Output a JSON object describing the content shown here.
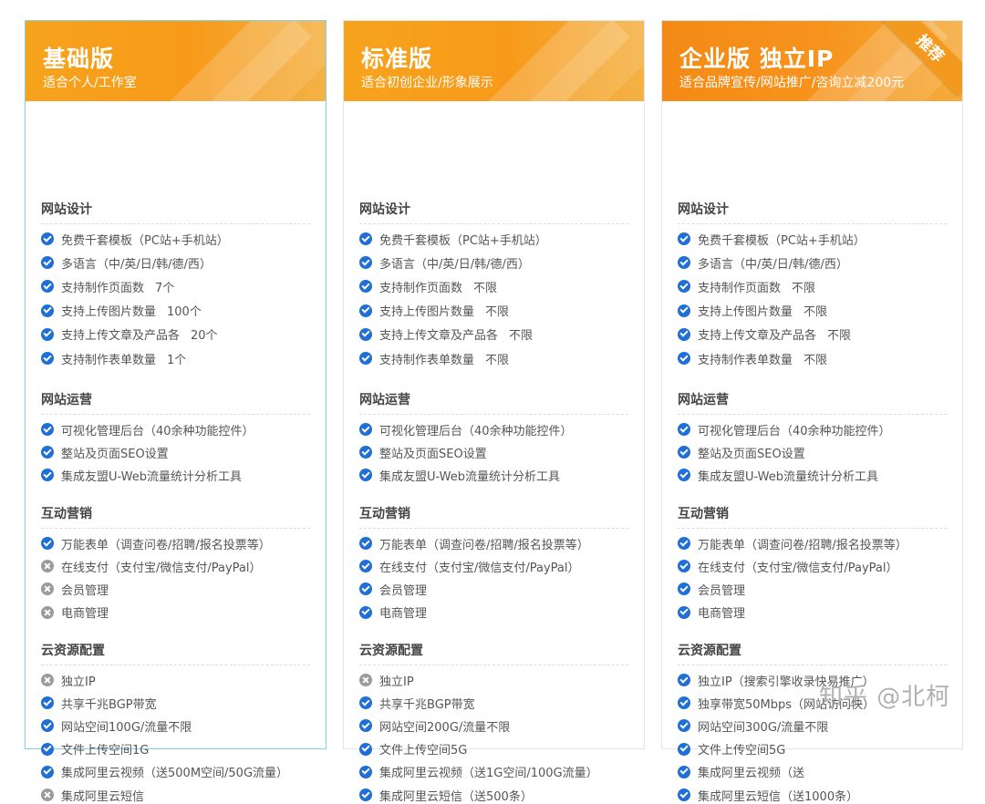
{
  "plans": [
    {
      "title": "基础版",
      "subtitle": "适合个人/工作室",
      "badge": "",
      "sections": [
        {
          "title": "网站设计",
          "items": [
            {
              "text": "免费千套模板（PC站+手机站）",
              "value": "",
              "status": "check"
            },
            {
              "text": "多语言（中/英/日/韩/德/西）",
              "value": "",
              "status": "check"
            },
            {
              "text": "支持制作页面数",
              "value": "7个",
              "status": "check"
            },
            {
              "text": "支持上传图片数量",
              "value": "100个",
              "status": "check"
            },
            {
              "text": "支持上传文章及产品各",
              "value": "20个",
              "status": "check"
            },
            {
              "text": "支持制作表单数量",
              "value": "1个",
              "status": "check"
            }
          ]
        },
        {
          "title": "网站运营",
          "items": [
            {
              "text": "可视化管理后台（40余种功能控件）",
              "value": "",
              "status": "check"
            },
            {
              "text": "整站及页面SEO设置",
              "value": "",
              "status": "check"
            },
            {
              "text": "集成友盟U-Web流量统计分析工具",
              "value": "",
              "status": "check"
            }
          ]
        },
        {
          "title": "互动营销",
          "items": [
            {
              "text": "万能表单（调查问卷/招聘/报名投票等）",
              "value": "",
              "status": "check"
            },
            {
              "text": "在线支付（支付宝/微信支付/PayPal）",
              "value": "",
              "status": "cross"
            },
            {
              "text": "会员管理",
              "value": "",
              "status": "cross"
            },
            {
              "text": "电商管理",
              "value": "",
              "status": "cross"
            }
          ]
        },
        {
          "title": "云资源配置",
          "items": [
            {
              "text": "独立IP",
              "value": "",
              "status": "cross"
            },
            {
              "text": "共享千兆BGP带宽",
              "value": "",
              "status": "check"
            },
            {
              "text": "网站空间100G/流量不限",
              "value": "",
              "status": "check"
            },
            {
              "text": "文件上传空间1G",
              "value": "",
              "status": "check"
            },
            {
              "text": "集成阿里云视频（送500M空间/50G流量）",
              "value": "",
              "status": "check"
            },
            {
              "text": "集成阿里云短信",
              "value": "",
              "status": "cross"
            }
          ]
        }
      ]
    },
    {
      "title": "标准版",
      "subtitle": "适合初创企业/形象展示",
      "badge": "",
      "sections": [
        {
          "title": "网站设计",
          "items": [
            {
              "text": "免费千套模板（PC站+手机站）",
              "value": "",
              "status": "check"
            },
            {
              "text": "多语言（中/英/日/韩/德/西）",
              "value": "",
              "status": "check"
            },
            {
              "text": "支持制作页面数",
              "value": "不限",
              "status": "check"
            },
            {
              "text": "支持上传图片数量",
              "value": "不限",
              "status": "check"
            },
            {
              "text": "支持上传文章及产品各",
              "value": "不限",
              "status": "check"
            },
            {
              "text": "支持制作表单数量",
              "value": "不限",
              "status": "check"
            }
          ]
        },
        {
          "title": "网站运营",
          "items": [
            {
              "text": "可视化管理后台（40余种功能控件）",
              "value": "",
              "status": "check"
            },
            {
              "text": "整站及页面SEO设置",
              "value": "",
              "status": "check"
            },
            {
              "text": "集成友盟U-Web流量统计分析工具",
              "value": "",
              "status": "check"
            }
          ]
        },
        {
          "title": "互动营销",
          "items": [
            {
              "text": "万能表单（调查问卷/招聘/报名投票等）",
              "value": "",
              "status": "check"
            },
            {
              "text": "在线支付（支付宝/微信支付/PayPal）",
              "value": "",
              "status": "check"
            },
            {
              "text": "会员管理",
              "value": "",
              "status": "check"
            },
            {
              "text": "电商管理",
              "value": "",
              "status": "check"
            }
          ]
        },
        {
          "title": "云资源配置",
          "items": [
            {
              "text": "独立IP",
              "value": "",
              "status": "cross"
            },
            {
              "text": "共享千兆BGP带宽",
              "value": "",
              "status": "check"
            },
            {
              "text": "网站空间200G/流量不限",
              "value": "",
              "status": "check"
            },
            {
              "text": "文件上传空间5G",
              "value": "",
              "status": "check"
            },
            {
              "text": "集成阿里云视频（送1G空间/100G流量）",
              "value": "",
              "status": "check"
            },
            {
              "text": "集成阿里云短信（送500条）",
              "value": "",
              "status": "check"
            }
          ]
        }
      ]
    },
    {
      "title": "企业版 独立IP",
      "subtitle": "适合品牌宣传/网站推广/咨询立减200元",
      "badge": "推荐",
      "sections": [
        {
          "title": "网站设计",
          "items": [
            {
              "text": "免费千套模板（PC站+手机站）",
              "value": "",
              "status": "check"
            },
            {
              "text": "多语言（中/英/日/韩/德/西）",
              "value": "",
              "status": "check"
            },
            {
              "text": "支持制作页面数",
              "value": "不限",
              "status": "check"
            },
            {
              "text": "支持上传图片数量",
              "value": "不限",
              "status": "check"
            },
            {
              "text": "支持上传文章及产品各",
              "value": "不限",
              "status": "check"
            },
            {
              "text": "支持制作表单数量",
              "value": "不限",
              "status": "check"
            }
          ]
        },
        {
          "title": "网站运营",
          "items": [
            {
              "text": "可视化管理后台（40余种功能控件）",
              "value": "",
              "status": "check"
            },
            {
              "text": "整站及页面SEO设置",
              "value": "",
              "status": "check"
            },
            {
              "text": "集成友盟U-Web流量统计分析工具",
              "value": "",
              "status": "check"
            }
          ]
        },
        {
          "title": "互动营销",
          "items": [
            {
              "text": "万能表单（调查问卷/招聘/报名投票等）",
              "value": "",
              "status": "check"
            },
            {
              "text": "在线支付（支付宝/微信支付/PayPal）",
              "value": "",
              "status": "check"
            },
            {
              "text": "会员管理",
              "value": "",
              "status": "check"
            },
            {
              "text": "电商管理",
              "value": "",
              "status": "check"
            }
          ]
        },
        {
          "title": "云资源配置",
          "items": [
            {
              "text": "独立IP（搜索引擎收录快易推广）",
              "value": "",
              "status": "check"
            },
            {
              "text": "独享带宽50Mbps（网站访问快）",
              "value": "",
              "status": "check"
            },
            {
              "text": "网站空间300G/流量不限",
              "value": "",
              "status": "check"
            },
            {
              "text": "文件上传空间5G",
              "value": "",
              "status": "check"
            },
            {
              "text": "集成阿里云视频（送",
              "value": "",
              "status": "check"
            },
            {
              "text": "集成阿里云短信（送1000条）",
              "value": "",
              "status": "check"
            }
          ]
        }
      ]
    }
  ],
  "watermark": "知乎 @北柯",
  "colors": {
    "header_orange": "#f79a1a",
    "check_blue": "#1f6fd6",
    "cross_gray": "#9b9b9b"
  }
}
